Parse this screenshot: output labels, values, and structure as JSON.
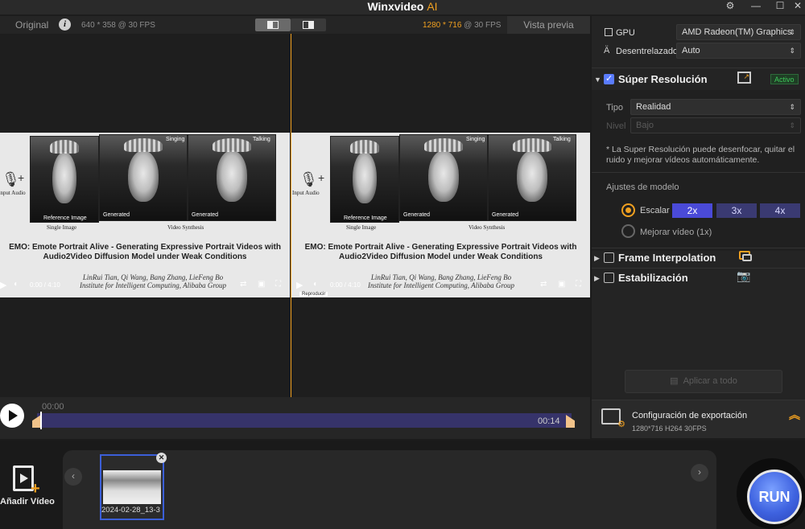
{
  "app": {
    "title": "Winxvideo",
    "title_suffix": "AI",
    "accent_color": "#f0a020",
    "window_controls": [
      "settings-icon",
      "minimize-icon",
      "maximize-icon",
      "close-icon"
    ]
  },
  "preview_bar": {
    "original_label": "Original",
    "original_res": "640 * 358 @ 30 FPS",
    "preview_res_value": "1280 * 716",
    "preview_res_suffix": " @ 30 FPS",
    "preview_label": "Vista previa"
  },
  "video_frame": {
    "input_audio": "Input Audio",
    "reference_label": "Reference Image",
    "generated_label_1": "Generated",
    "generated_label_2": "Generated",
    "singing": "Singing",
    "talking": "Talking",
    "single_image": "Single Image",
    "video_synthesis": "Video Synthesis",
    "title_line1": "EMO: Emote Portrait Alive - Generating Expressive Portrait Videos with",
    "title_line2": "Audio2Video Diffusion Model under Weak Conditions",
    "authors_line1": "LinRui Tian, Qi Wang, Bang Zhang, LieFeng Bo",
    "authors_line2": "Institute for Intelligent Computing, Alibaba Group",
    "player_time": "0:00 / 4:10",
    "tooltip": "Reproducir"
  },
  "timeline": {
    "start_time": "00:00",
    "end_time": "00:14",
    "playhead_progress": 0.01
  },
  "panel": {
    "gpu_label": "GPU",
    "gpu_value": "AMD Radeon(TM) Graphics",
    "deinterlace_label": "Desentrelazado",
    "deinterlace_value": "Auto",
    "super_res": {
      "title": "Súper Resolución",
      "status": "Activo",
      "checked": true,
      "type_label": "Tipo",
      "type_value": "Realidad",
      "level_label": "Nivel",
      "level_value": "Bajo",
      "note": "* La Super Resolución puede desenfocar, quitar el ruido y mejorar vídeos automáticamente.",
      "model_label": "Ajustes de modelo",
      "scale_label": "Escalar",
      "scales": [
        "2x",
        "3x",
        "4x"
      ],
      "selected_scale": "2x",
      "enhance_label": "Mejorar vídeo (1x)"
    },
    "frame_interp": {
      "title": "Frame Interpolation",
      "checked": false
    },
    "stabilize": {
      "title": "Estabilización",
      "checked": false
    },
    "apply_all": "Aplicar a todo"
  },
  "export": {
    "title": "Configuración de exportación",
    "details": "1280*716  H264  30FPS"
  },
  "bottom": {
    "add_video": "Añadir Vídeo",
    "clip_name": "2024-02-28_13-3",
    "run": "RUN"
  }
}
